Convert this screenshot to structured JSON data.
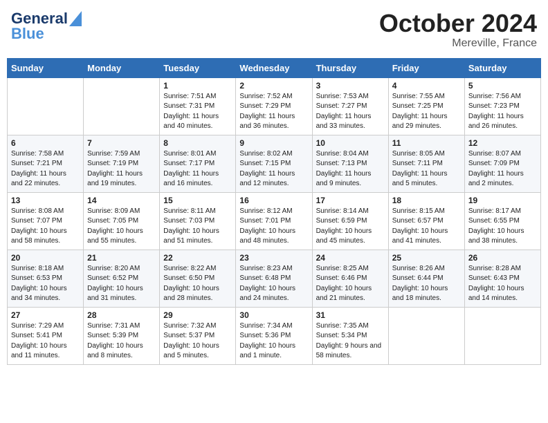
{
  "header": {
    "logo_line1": "General",
    "logo_line2": "Blue",
    "month": "October 2024",
    "location": "Mereville, France"
  },
  "days_of_week": [
    "Sunday",
    "Monday",
    "Tuesday",
    "Wednesday",
    "Thursday",
    "Friday",
    "Saturday"
  ],
  "weeks": [
    [
      {
        "day": "",
        "sunrise": "",
        "sunset": "",
        "daylight": ""
      },
      {
        "day": "",
        "sunrise": "",
        "sunset": "",
        "daylight": ""
      },
      {
        "day": "1",
        "sunrise": "Sunrise: 7:51 AM",
        "sunset": "Sunset: 7:31 PM",
        "daylight": "Daylight: 11 hours and 40 minutes."
      },
      {
        "day": "2",
        "sunrise": "Sunrise: 7:52 AM",
        "sunset": "Sunset: 7:29 PM",
        "daylight": "Daylight: 11 hours and 36 minutes."
      },
      {
        "day": "3",
        "sunrise": "Sunrise: 7:53 AM",
        "sunset": "Sunset: 7:27 PM",
        "daylight": "Daylight: 11 hours and 33 minutes."
      },
      {
        "day": "4",
        "sunrise": "Sunrise: 7:55 AM",
        "sunset": "Sunset: 7:25 PM",
        "daylight": "Daylight: 11 hours and 29 minutes."
      },
      {
        "day": "5",
        "sunrise": "Sunrise: 7:56 AM",
        "sunset": "Sunset: 7:23 PM",
        "daylight": "Daylight: 11 hours and 26 minutes."
      }
    ],
    [
      {
        "day": "6",
        "sunrise": "Sunrise: 7:58 AM",
        "sunset": "Sunset: 7:21 PM",
        "daylight": "Daylight: 11 hours and 22 minutes."
      },
      {
        "day": "7",
        "sunrise": "Sunrise: 7:59 AM",
        "sunset": "Sunset: 7:19 PM",
        "daylight": "Daylight: 11 hours and 19 minutes."
      },
      {
        "day": "8",
        "sunrise": "Sunrise: 8:01 AM",
        "sunset": "Sunset: 7:17 PM",
        "daylight": "Daylight: 11 hours and 16 minutes."
      },
      {
        "day": "9",
        "sunrise": "Sunrise: 8:02 AM",
        "sunset": "Sunset: 7:15 PM",
        "daylight": "Daylight: 11 hours and 12 minutes."
      },
      {
        "day": "10",
        "sunrise": "Sunrise: 8:04 AM",
        "sunset": "Sunset: 7:13 PM",
        "daylight": "Daylight: 11 hours and 9 minutes."
      },
      {
        "day": "11",
        "sunrise": "Sunrise: 8:05 AM",
        "sunset": "Sunset: 7:11 PM",
        "daylight": "Daylight: 11 hours and 5 minutes."
      },
      {
        "day": "12",
        "sunrise": "Sunrise: 8:07 AM",
        "sunset": "Sunset: 7:09 PM",
        "daylight": "Daylight: 11 hours and 2 minutes."
      }
    ],
    [
      {
        "day": "13",
        "sunrise": "Sunrise: 8:08 AM",
        "sunset": "Sunset: 7:07 PM",
        "daylight": "Daylight: 10 hours and 58 minutes."
      },
      {
        "day": "14",
        "sunrise": "Sunrise: 8:09 AM",
        "sunset": "Sunset: 7:05 PM",
        "daylight": "Daylight: 10 hours and 55 minutes."
      },
      {
        "day": "15",
        "sunrise": "Sunrise: 8:11 AM",
        "sunset": "Sunset: 7:03 PM",
        "daylight": "Daylight: 10 hours and 51 minutes."
      },
      {
        "day": "16",
        "sunrise": "Sunrise: 8:12 AM",
        "sunset": "Sunset: 7:01 PM",
        "daylight": "Daylight: 10 hours and 48 minutes."
      },
      {
        "day": "17",
        "sunrise": "Sunrise: 8:14 AM",
        "sunset": "Sunset: 6:59 PM",
        "daylight": "Daylight: 10 hours and 45 minutes."
      },
      {
        "day": "18",
        "sunrise": "Sunrise: 8:15 AM",
        "sunset": "Sunset: 6:57 PM",
        "daylight": "Daylight: 10 hours and 41 minutes."
      },
      {
        "day": "19",
        "sunrise": "Sunrise: 8:17 AM",
        "sunset": "Sunset: 6:55 PM",
        "daylight": "Daylight: 10 hours and 38 minutes."
      }
    ],
    [
      {
        "day": "20",
        "sunrise": "Sunrise: 8:18 AM",
        "sunset": "Sunset: 6:53 PM",
        "daylight": "Daylight: 10 hours and 34 minutes."
      },
      {
        "day": "21",
        "sunrise": "Sunrise: 8:20 AM",
        "sunset": "Sunset: 6:52 PM",
        "daylight": "Daylight: 10 hours and 31 minutes."
      },
      {
        "day": "22",
        "sunrise": "Sunrise: 8:22 AM",
        "sunset": "Sunset: 6:50 PM",
        "daylight": "Daylight: 10 hours and 28 minutes."
      },
      {
        "day": "23",
        "sunrise": "Sunrise: 8:23 AM",
        "sunset": "Sunset: 6:48 PM",
        "daylight": "Daylight: 10 hours and 24 minutes."
      },
      {
        "day": "24",
        "sunrise": "Sunrise: 8:25 AM",
        "sunset": "Sunset: 6:46 PM",
        "daylight": "Daylight: 10 hours and 21 minutes."
      },
      {
        "day": "25",
        "sunrise": "Sunrise: 8:26 AM",
        "sunset": "Sunset: 6:44 PM",
        "daylight": "Daylight: 10 hours and 18 minutes."
      },
      {
        "day": "26",
        "sunrise": "Sunrise: 8:28 AM",
        "sunset": "Sunset: 6:43 PM",
        "daylight": "Daylight: 10 hours and 14 minutes."
      }
    ],
    [
      {
        "day": "27",
        "sunrise": "Sunrise: 7:29 AM",
        "sunset": "Sunset: 5:41 PM",
        "daylight": "Daylight: 10 hours and 11 minutes."
      },
      {
        "day": "28",
        "sunrise": "Sunrise: 7:31 AM",
        "sunset": "Sunset: 5:39 PM",
        "daylight": "Daylight: 10 hours and 8 minutes."
      },
      {
        "day": "29",
        "sunrise": "Sunrise: 7:32 AM",
        "sunset": "Sunset: 5:37 PM",
        "daylight": "Daylight: 10 hours and 5 minutes."
      },
      {
        "day": "30",
        "sunrise": "Sunrise: 7:34 AM",
        "sunset": "Sunset: 5:36 PM",
        "daylight": "Daylight: 10 hours and 1 minute."
      },
      {
        "day": "31",
        "sunrise": "Sunrise: 7:35 AM",
        "sunset": "Sunset: 5:34 PM",
        "daylight": "Daylight: 9 hours and 58 minutes."
      },
      {
        "day": "",
        "sunrise": "",
        "sunset": "",
        "daylight": ""
      },
      {
        "day": "",
        "sunrise": "",
        "sunset": "",
        "daylight": ""
      }
    ]
  ]
}
